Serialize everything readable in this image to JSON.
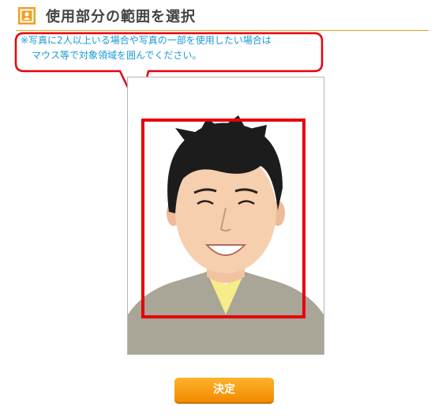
{
  "header": {
    "title": "使用部分の範囲を選択",
    "icon": "person-crop-icon",
    "accent_color": "#f0a020"
  },
  "notice": {
    "line1": "※写真に2人以上いる場合や写真の一部を使用したい場合は",
    "line2": "マウス等で対象領域を囲んでください。",
    "text_color": "#1a9ad6",
    "callout_border_color": "#e8000c"
  },
  "photo": {
    "description_icon": "portrait-photo",
    "selection_color": "#e8000c"
  },
  "actions": {
    "decide_label": "決定",
    "button_color": "#f5a000"
  }
}
